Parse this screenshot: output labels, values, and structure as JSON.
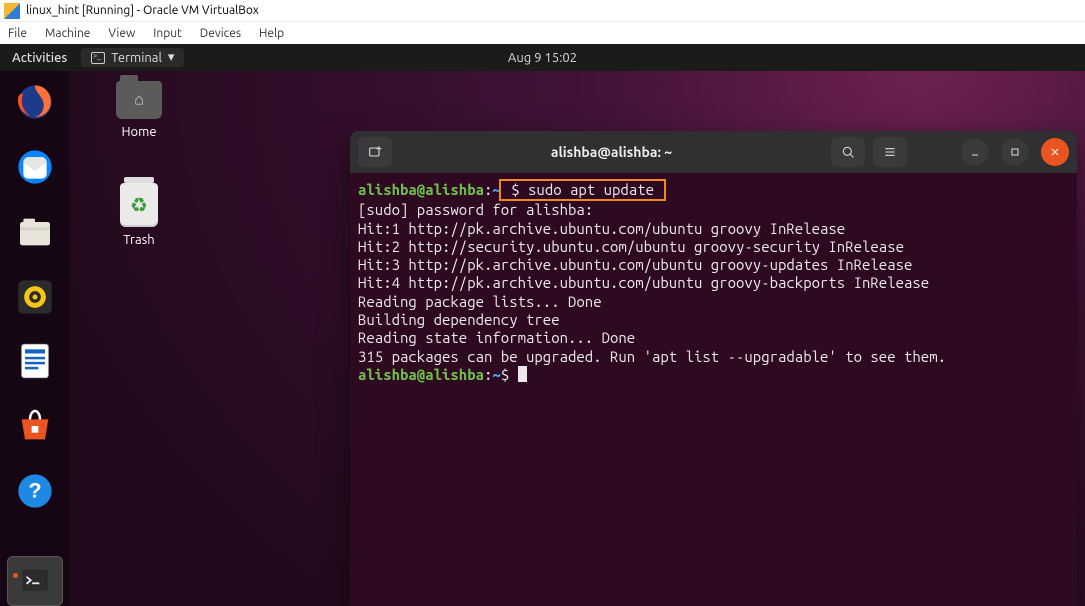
{
  "host_window": {
    "title": "linux_hint [Running] - Oracle VM VirtualBox",
    "menu": {
      "file": "File",
      "machine": "Machine",
      "view": "View",
      "input": "Input",
      "devices": "Devices",
      "help": "Help"
    }
  },
  "topbar": {
    "activities": "Activities",
    "active_app_label": "Terminal",
    "clock": "Aug 9  15:02"
  },
  "desktop_icons": {
    "home": "Home",
    "trash": "Trash"
  },
  "dock": {
    "items": [
      {
        "name": "firefox"
      },
      {
        "name": "thunderbird"
      },
      {
        "name": "files"
      },
      {
        "name": "rhythmbox"
      },
      {
        "name": "libreoffice-writer"
      },
      {
        "name": "ubuntu-software"
      },
      {
        "name": "help"
      }
    ],
    "running": {
      "name": "terminal"
    }
  },
  "terminal": {
    "title": "alishba@alishba: ~",
    "prompt": {
      "user_host": "alishba@alishba",
      "sep": ":",
      "path": "~",
      "sigil": "$"
    },
    "command_highlighted": " $ sudo apt update ",
    "lines": [
      "[sudo] password for alishba:",
      "Hit:1 http://pk.archive.ubuntu.com/ubuntu groovy InRelease",
      "Hit:2 http://security.ubuntu.com/ubuntu groovy-security InRelease",
      "Hit:3 http://pk.archive.ubuntu.com/ubuntu groovy-updates InRelease",
      "Hit:4 http://pk.archive.ubuntu.com/ubuntu groovy-backports InRelease",
      "Reading package lists... Done",
      "Building dependency tree",
      "Reading state information... Done",
      "315 packages can be upgraded. Run 'apt list --upgradable' to see them."
    ]
  }
}
